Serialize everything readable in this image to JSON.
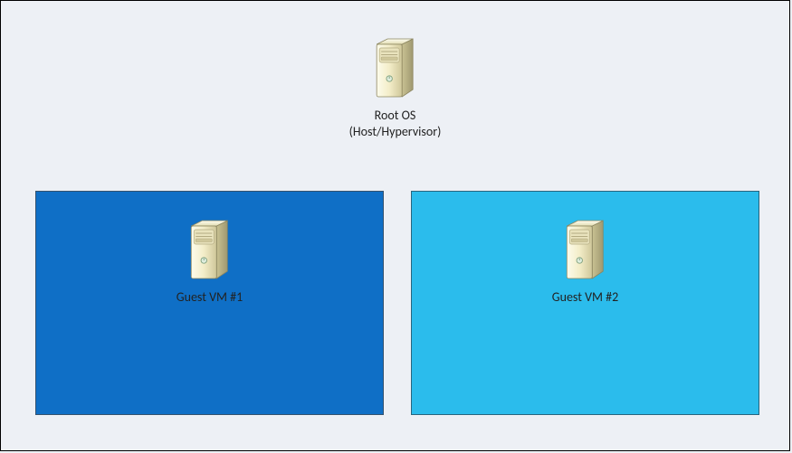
{
  "root": {
    "label_line1": "Root OS",
    "label_line2": "(Host/Hypervisor)",
    "icon": "server-tower-icon"
  },
  "guests": [
    {
      "label": "Guest VM #1",
      "bg_color": "#0f6fc6",
      "icon": "server-tower-icon"
    },
    {
      "label": "Guest VM #2",
      "bg_color": "#2bbcec",
      "icon": "server-tower-icon"
    }
  ],
  "canvas": {
    "border_color": "#000000",
    "bg_color": "#edf0f5"
  }
}
